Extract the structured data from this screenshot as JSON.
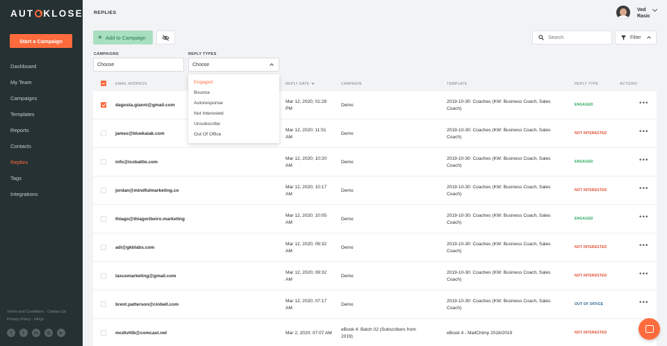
{
  "brand": {
    "logo_pre": "AUT",
    "logo_post": "KLOSE"
  },
  "sidebar": {
    "start_campaign": "Start a Campaign",
    "items": [
      {
        "label": "Dashboard"
      },
      {
        "label": "My Team"
      },
      {
        "label": "Campaigns"
      },
      {
        "label": "Templates"
      },
      {
        "label": "Reports"
      },
      {
        "label": "Contacts"
      },
      {
        "label": "Replies",
        "active": true
      },
      {
        "label": "Tags"
      },
      {
        "label": "Integrations"
      }
    ],
    "footer_line1": "Terms and Conditions · Contact Us",
    "footer_line2": "Privacy Policy · FAQs",
    "social": [
      "facebook-icon",
      "twitter-icon",
      "linkedin-icon",
      "instagram-icon",
      "youtube-icon"
    ]
  },
  "header": {
    "title": "REPLIES",
    "user_first": "Ved",
    "user_last": "Rasic"
  },
  "toolbar": {
    "add_label": "Add to Campaign",
    "search_placeholder": "Search",
    "filter_label": "Filter"
  },
  "filters": {
    "campaigns_label": "CAMPAIGNS",
    "campaigns_value": "Choose",
    "reply_types_label": "REPLY TYPES",
    "reply_types_value": "Choose",
    "reply_types_options": [
      "Engaged",
      "Bounce",
      "Autoresponse",
      "Not Interested",
      "Unsubscribe",
      "Out Of Office"
    ]
  },
  "table": {
    "headers": {
      "email": "EMAIL ADDRESS",
      "date": "REPLY DATE",
      "campaign": "CAMPAIGN",
      "template": "TEMPLATE",
      "type": "REPLY TYPE",
      "actions": "ACTIONS"
    },
    "rows": [
      {
        "email": "dagosta.gianni@gmail.com",
        "date1": "Mar 12, 2020; 01:28",
        "date2": "PM",
        "campaign1": "Demo",
        "campaign2": "",
        "template1": "2019-10-30: Coaches (KW: Business Coach, Sales",
        "template2": "Coach)",
        "type": "ENGAGED",
        "checked": true
      },
      {
        "email": "james@bluekaiak.com",
        "date1": "Mar 12, 2020; 11:51",
        "date2": "AM",
        "campaign1": "Demo",
        "campaign2": "",
        "template1": "2019-10-30: Coaches (KW: Business Coach, Sales",
        "template2": "Coach)",
        "type": "NOT INTERESTED"
      },
      {
        "email": "info@icobattle.com",
        "date1": "Mar 12, 2020; 10:20",
        "date2": "AM",
        "campaign1": "Demo",
        "campaign2": "",
        "template1": "2019-10-30: Coaches (KW: Business Coach, Sales",
        "template2": "Coach)",
        "type": "ENGAGED"
      },
      {
        "email": "jordan@mindfulmarketing.co",
        "date1": "Mar 12, 2020; 10:17",
        "date2": "AM",
        "campaign1": "Demo",
        "campaign2": "",
        "template1": "2019-10-30: Coaches (KW: Business Coach, Sales",
        "template2": "Coach)",
        "type": "NOT INTERESTED"
      },
      {
        "email": "thiago@thiagoribeiro.marketing",
        "date1": "Mar 12, 2020; 10:05",
        "date2": "AM",
        "campaign1": "Demo",
        "campaign2": "",
        "template1": "2019-10-30: Coaches (KW: Business Coach, Sales",
        "template2": "Coach)",
        "type": "ENGAGED"
      },
      {
        "email": "adi@gkblabs.com",
        "date1": "Mar 12, 2020; 09:32",
        "date2": "AM",
        "campaign1": "Demo",
        "campaign2": "",
        "template1": "2019-10-30: Coaches (KW: Business Coach, Sales",
        "template2": "Coach)",
        "type": "NOT INTERESTED"
      },
      {
        "email": "laxusmarketing@gmail.com",
        "date1": "Mar 12, 2020; 09:32",
        "date2": "AM",
        "campaign1": "Demo",
        "campaign2": "",
        "template1": "2019-10-30: Coaches (KW: Business Coach, Sales",
        "template2": "Coach)",
        "type": "NOT INTERESTED"
      },
      {
        "email": "brent.patterson@cinbell.com",
        "date1": "Mar 12, 2020; 07:17",
        "date2": "AM",
        "campaign1": "Demo",
        "campaign2": "",
        "template1": "2019-10-30: Coaches (KW: Business Coach, Sales",
        "template2": "Coach)",
        "type": "OUT OF OFFICE"
      },
      {
        "email": "mcdivittb@comcast.net",
        "date1": "Mar 2, 2020; 07:07 AM",
        "date2": "",
        "campaign1": "eBook 4: Batch 02 (Subscribers from",
        "campaign2": "2019)",
        "template1": "eBook 4 - MailChimp 2018/2019",
        "template2": "",
        "type": "NOT INTERESTED"
      }
    ]
  },
  "colors": {
    "accent": "#ff6b3d",
    "engaged": "#27a55a",
    "not_interested": "#e04a2e",
    "out_of_office": "#1f5f8b",
    "sidebar": "#253133"
  }
}
